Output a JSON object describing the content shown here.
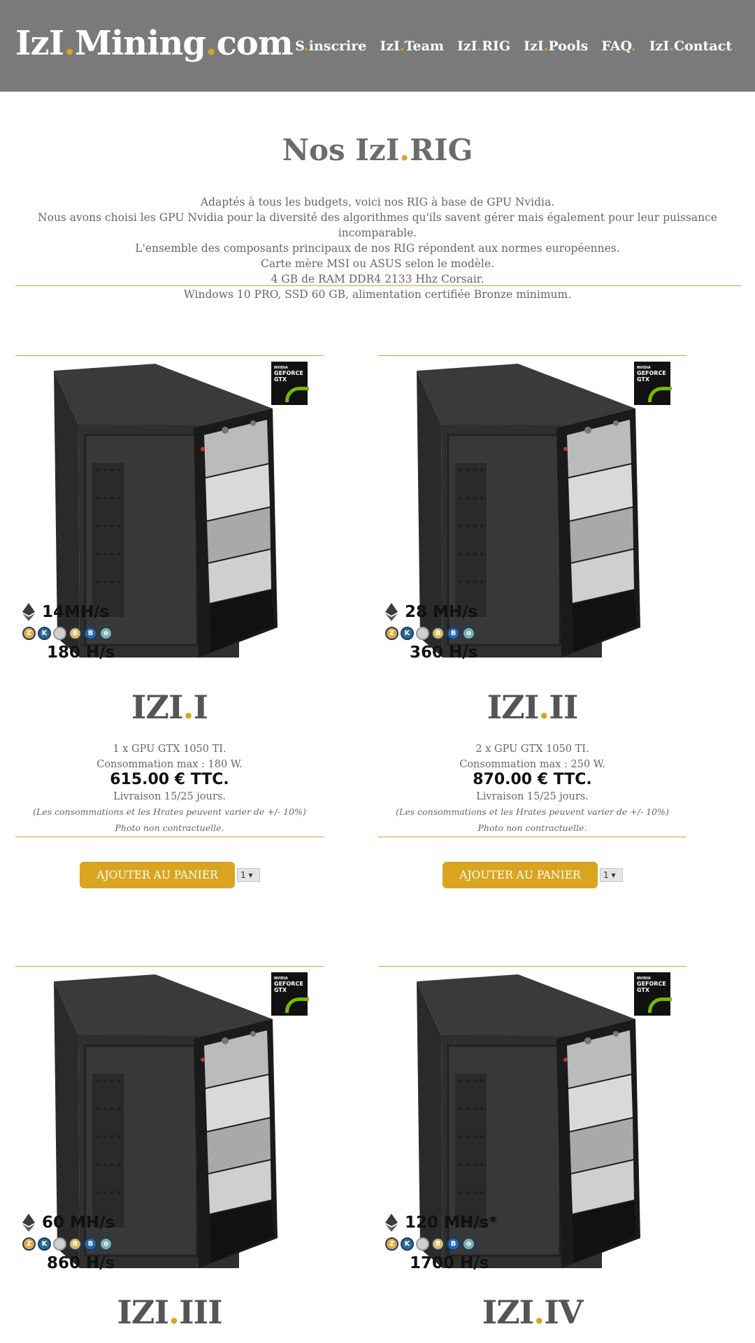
{
  "brand": {
    "part1": "IzI",
    "dot": ".",
    "part2": "Mining",
    "dot2": ".",
    "part3": "com"
  },
  "nav": [
    {
      "a": "S",
      "dot": ".",
      "b": "inscrire"
    },
    {
      "a": "IzI",
      "dot": ".",
      "b": "Team"
    },
    {
      "a": "IzI",
      "dot": ".",
      "b": "RIG"
    },
    {
      "a": "IzI",
      "dot": ".",
      "b": "Pools"
    },
    {
      "a": "FAQ",
      "dot": ".",
      "b": ""
    },
    {
      "a": "IzI",
      "dot": ".",
      "b": "Contact"
    }
  ],
  "page": {
    "title_a": "Nos IzI",
    "title_dot": ".",
    "title_b": "RIG",
    "intro": [
      "Adaptés à tous les budgets, voici nos RIG à base de GPU Nvidia.",
      "Nous avons choisi les GPU Nvidia pour la diversité des algorithmes qu'ils savent gérer mais également pour leur puissance incomparable.",
      "L'ensemble des composants principaux de nos RIG répondent aux normes européennes.",
      "Carte mère MSI ou ASUS selon le modèle.",
      "4 GB de RAM DDR4 2133 Hhz Corsair.",
      "Windows 10 PRO, SSD 60 GB, alimentation certifiée Bronze minimum."
    ]
  },
  "badge": {
    "line1": "NVIDIA",
    "line2": "GEFORCE",
    "line3": "GTX"
  },
  "products": [
    {
      "name_a": "IZI",
      "name_dot": ".",
      "name_b": "I",
      "hash_eth": "14MH/s",
      "hash_other": "180 H/s",
      "gpu": "1 x GPU GTX 1050 TI.",
      "consumption": "Consommation max : 180 W.",
      "price": "615.00 € TTC.",
      "delivery": "Livraison 15/25 jours.",
      "note": "(Les consommations et les Hrates peuvent varier de +/- 10%)",
      "photo": "Photo non contractuelle.",
      "cart": "AJOUTER AU PANIER",
      "qty": "1"
    },
    {
      "name_a": "IZI",
      "name_dot": ".",
      "name_b": "II",
      "hash_eth": "28 MH/s",
      "hash_other": "360 H/s",
      "gpu": "2 x GPU GTX 1050 TI.",
      "consumption": "Consommation max : 250 W.",
      "price": "870.00 € TTC.",
      "delivery": "Livraison 15/25 jours.",
      "note": "(Les consommations et les Hrates peuvent varier de +/- 10%)",
      "photo": "Photo non contractuelle.",
      "cart": "AJOUTER AU PANIER",
      "qty": "1"
    },
    {
      "name_a": "IZI",
      "name_dot": ".",
      "name_b": "III",
      "hash_eth": "60 MH/s",
      "hash_other": "860 H/s"
    },
    {
      "name_a": "IZI",
      "name_dot": ".",
      "name_b": "IV",
      "hash_eth": "120 MH/s*",
      "hash_other": "1700 H/s"
    }
  ],
  "coin_icons": [
    "zcash-icon",
    "komodo-icon",
    "zencash-icon",
    "bitcoin-gold-icon",
    "bitcoin-icon",
    "hush-icon"
  ],
  "colors": {
    "header_bg": "#7a7a7a",
    "accent": "#d9a521",
    "text": "#666666"
  }
}
